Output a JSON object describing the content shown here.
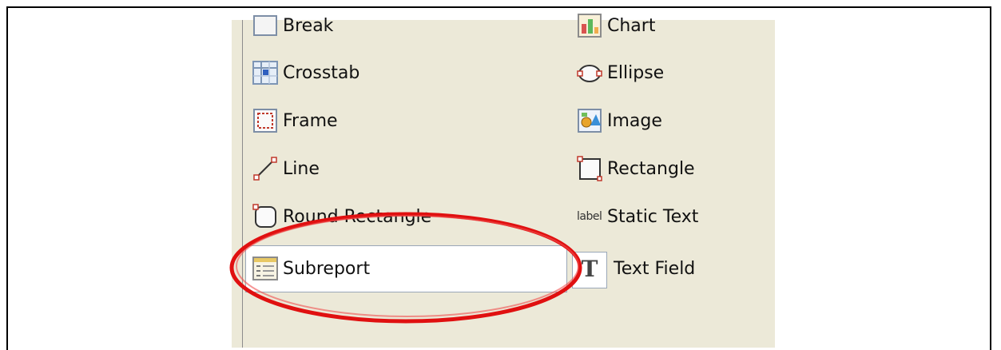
{
  "palette": {
    "left_column": [
      {
        "label": "Break",
        "icon": "break-icon"
      },
      {
        "label": "Crosstab",
        "icon": "crosstab-icon"
      },
      {
        "label": "Frame",
        "icon": "frame-icon"
      },
      {
        "label": "Line",
        "icon": "line-icon"
      },
      {
        "label": "Round Rectangle",
        "icon": "round-rectangle-icon"
      },
      {
        "label": "Subreport",
        "icon": "subreport-icon"
      }
    ],
    "right_column": [
      {
        "label": "Chart",
        "icon": "chart-icon"
      },
      {
        "label": "Ellipse",
        "icon": "ellipse-icon"
      },
      {
        "label": "Image",
        "icon": "image-icon"
      },
      {
        "label": "Rectangle",
        "icon": "rectangle-icon"
      },
      {
        "label": "Static Text",
        "icon": "static-text-icon",
        "icon_text": "label"
      },
      {
        "label": "Text Field",
        "icon": "text-field-icon",
        "icon_text": "T"
      }
    ],
    "selected": "Subreport",
    "annotation_color": "#e01010"
  }
}
